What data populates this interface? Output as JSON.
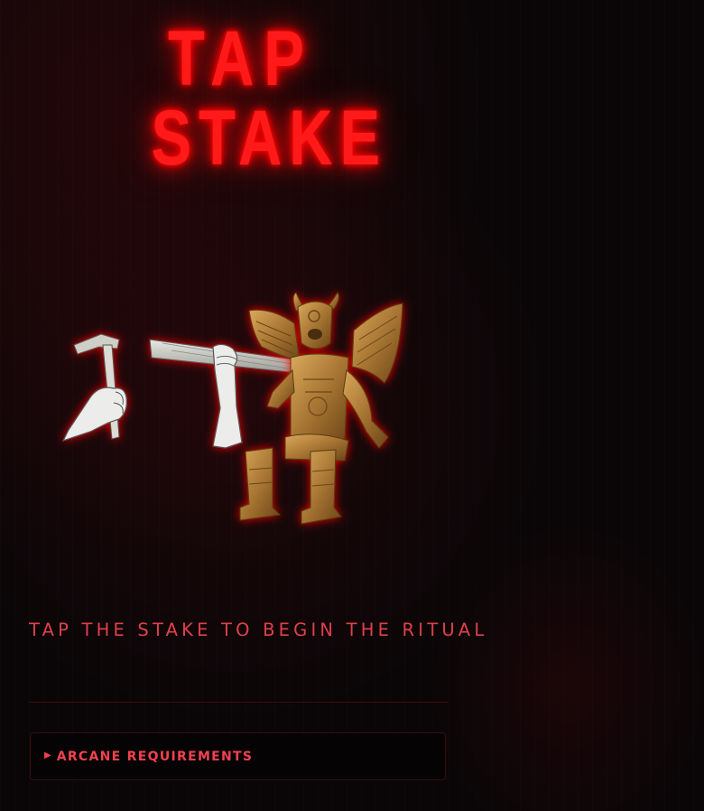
{
  "title": {
    "line1": "TAP",
    "line2": "STAKE"
  },
  "scene": {
    "hammer_icon": "hammer-in-hand",
    "stake_icon": "wooden-stake-in-hand",
    "idol_icon": "winged-bronze-idol"
  },
  "instruction": "TAP THE STAKE TO BEGIN THE RITUAL",
  "requirements": {
    "arrow": "▶",
    "label": "ARCANE REQUIREMENTS",
    "expanded": false
  },
  "colors": {
    "neon_red": "#ff1a1a",
    "text_red": "#e0404a",
    "accent_red": "#f2424e",
    "background": "#0a0607",
    "bronze": "#a67a3a"
  }
}
